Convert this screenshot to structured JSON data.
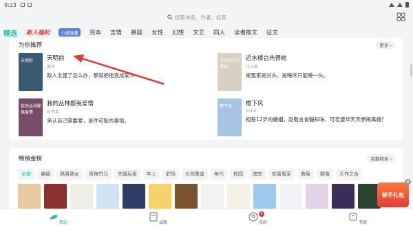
{
  "status": {
    "time": "9:23"
  },
  "search": {
    "placeholder": "搜索书名、作者、标签"
  },
  "tabs": [
    {
      "label": "精选",
      "kind": "active"
    },
    {
      "label": "新人福利",
      "kind": "hot"
    },
    {
      "label": "小说连载",
      "kind": "badge"
    },
    {
      "label": "完本"
    },
    {
      "label": "言情"
    },
    {
      "label": "悬疑"
    },
    {
      "label": "女性"
    },
    {
      "label": "幻想"
    },
    {
      "label": "文艺"
    },
    {
      "label": "同人"
    },
    {
      "label": "读者推文"
    },
    {
      "label": "征文"
    }
  ],
  "recommend": {
    "title": "为你推荐",
    "more_label": "更多 ›",
    "books": [
      {
        "title": "天明前",
        "author": "黄华",
        "desc": "敌人太强了怎么办，那就把他变成爱人",
        "cover_text": "天明前",
        "cover_color": "#3a5a73"
      },
      {
        "title": "近水楼台先得她",
        "author": "江小鱼",
        "desc": "是冤家是对头，是睡床只能睡一头。",
        "cover_text": "近水楼台先得她",
        "cover_color": "#d8d1c2"
      },
      {
        "title": "我的丛林鄙夷爱情",
        "author": "叶不弃",
        "desc": "承认自己需要爱，是件可耻的事情。",
        "cover_text": "我的丛林鄙夷爱情",
        "cover_color": "#7a4a6a"
      },
      {
        "title": "檐下风",
        "author": "1900",
        "desc": "相差12岁的婚姻，赵敬言食髓知味，可老婆却天天想闹离婚？",
        "cover_text": "檐下风",
        "cover_color": "#a7c4e4"
      }
    ]
  },
  "ranking": {
    "title": "畅销金榜",
    "more_label": "完整榜单 ›",
    "chips": [
      "全部",
      "悬疑",
      "熟男熟女",
      "青梅竹马",
      "先婚后爱",
      "年上",
      "职场",
      "久别重逢",
      "年代",
      "校园",
      "暗恋",
      "欢喜冤家",
      "救赎",
      "群像",
      "天作之合"
    ],
    "cover_colors": [
      "#e8c9a0",
      "#8c2f2f",
      "#f0efe6",
      "#cfe3f2",
      "#2f3d66",
      "#f6d36a",
      "#7a5230",
      "#f2f2f2",
      "#f4f1e6",
      "#9fc9ee",
      "#f0f2f4",
      "#e4d3e8",
      "#3a2d5a",
      "#2a4230",
      "#f0e6d2",
      "#ddeef6"
    ]
  },
  "promo": {
    "label": "新手礼包",
    "close": "×"
  },
  "bottom_nav": [
    {
      "label": "精选",
      "active": true
    },
    {
      "label": "出版"
    },
    {
      "label": "我的",
      "badge": "4"
    },
    {
      "label": "书架"
    }
  ],
  "colors": {
    "accent": "#2eb8a3",
    "hot": "#e53935"
  }
}
